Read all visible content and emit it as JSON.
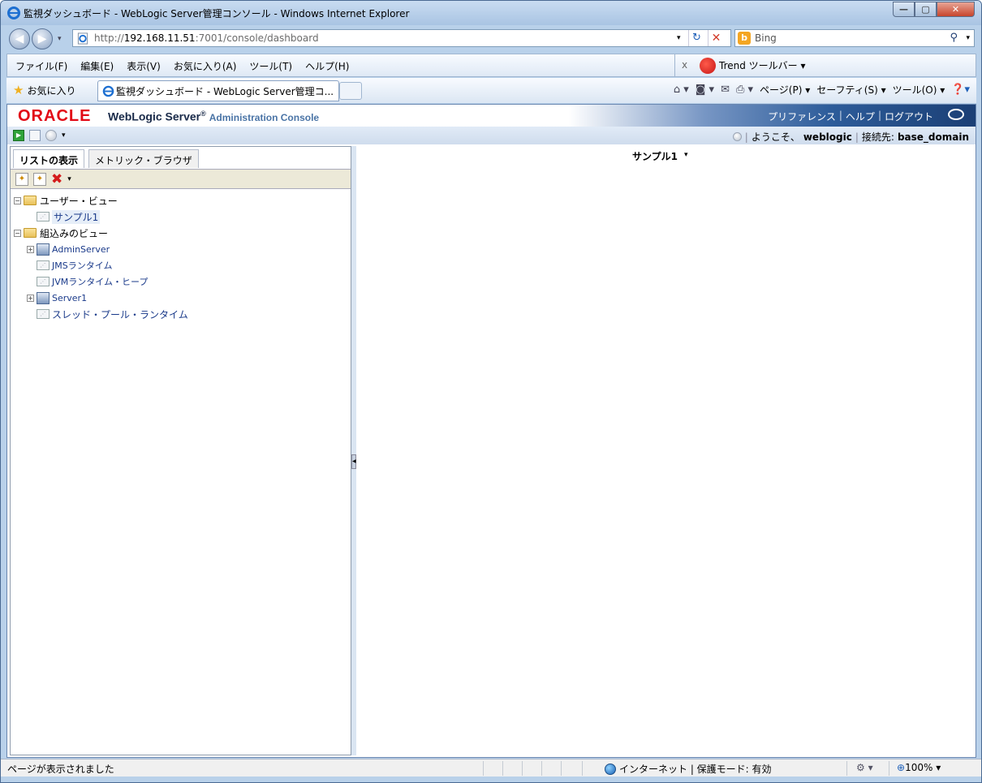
{
  "browser": {
    "title": "監視ダッシュボード - WebLogic Server管理コンソール - Windows Internet Explorer",
    "url_prefix": "http://",
    "url_host": "192.168.11.51",
    "url_rest": ":7001/console/dashboard",
    "search_provider": "Bing",
    "menu": [
      "ファイル(F)",
      "編集(E)",
      "表示(V)",
      "お気に入り(A)",
      "ツール(T)",
      "ヘルプ(H)"
    ],
    "trend_close": "x",
    "trend_label": "Trend ツールバー ▾",
    "favorites_label": "お気に入り",
    "tab_title": "監視ダッシュボード - WebLogic Server管理コ...",
    "commands": [
      "ページ(P) ▾",
      "セーフティ(S) ▾",
      "ツール(O) ▾"
    ]
  },
  "console": {
    "oracle": "ORACLE",
    "product": "WebLogic Server",
    "product_sup": "®",
    "subtitle": "Administration Console",
    "links": [
      "プリファレンス",
      "ヘルプ",
      "ログアウト"
    ],
    "welcome": "ようこそ、",
    "user": "weblogic",
    "connected": "接続先:",
    "domain": "base_domain"
  },
  "left_panel": {
    "tabs": [
      "リストの表示",
      "メトリック・ブラウザ"
    ],
    "tree": [
      {
        "label": "ユーザー・ビュー",
        "kind": "folder",
        "level": 0,
        "toggle": "⊟"
      },
      {
        "label": "サンプル1",
        "kind": "view",
        "level": 1,
        "selected": true
      },
      {
        "label": "組込みのビュー",
        "kind": "folder",
        "level": 0,
        "toggle": "⊟"
      },
      {
        "label": "AdminServer",
        "kind": "server",
        "level": 1,
        "toggle": "⊞"
      },
      {
        "label": "JMSランタイム",
        "kind": "view",
        "level": 1
      },
      {
        "label": "JVMランタイム・ヒープ",
        "kind": "view",
        "level": 1
      },
      {
        "label": "Server1",
        "kind": "server",
        "level": 1,
        "toggle": "⊞"
      },
      {
        "label": "スレッド・プール・ランタイム",
        "kind": "view",
        "level": 1
      }
    ]
  },
  "right_panel": {
    "view_title": "サンプル1"
  },
  "status": {
    "message": "ページが表示されました",
    "zone": "インターネット | 保護モード: 有効",
    "zoom": "100%"
  }
}
